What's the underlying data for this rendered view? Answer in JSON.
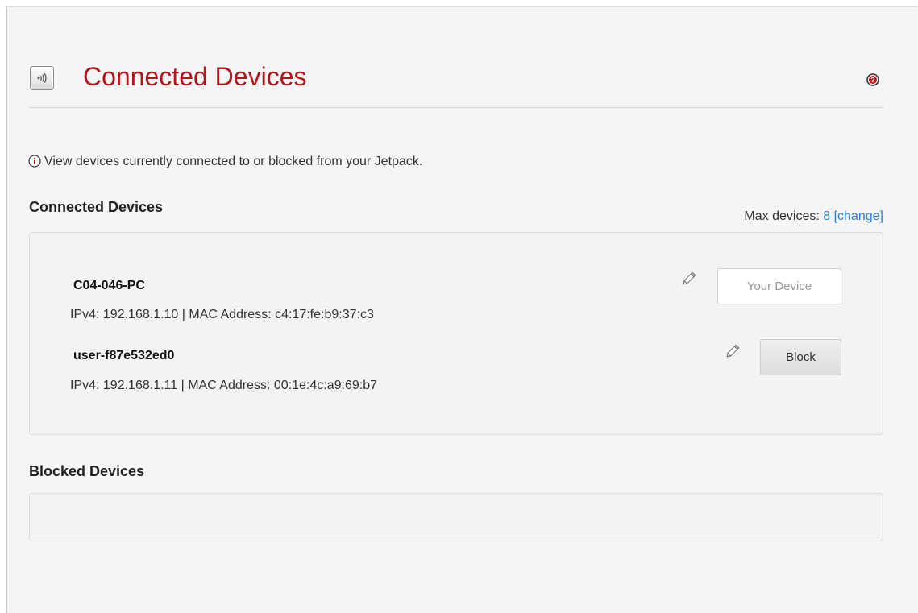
{
  "header": {
    "title": "Connected Devices",
    "device_icon": "wireless-device-icon",
    "help_icon": "help-icon"
  },
  "info": {
    "icon": "info-icon",
    "text": "View devices currently connected to or blocked from your Jetpack."
  },
  "connected_section": {
    "title": "Connected Devices",
    "max_devices_label": "Max devices:",
    "max_devices_value": "8",
    "change_link": "[change]"
  },
  "devices": [
    {
      "name": "C04-046-PC",
      "details": "IPv4: 192.168.1.10 | MAC Address: c4:17:fe:b9:37:c3",
      "edit_icon": "pencil-icon",
      "button_label": "Your Device"
    },
    {
      "name": "user-f87e532ed0",
      "details": "IPv4: 192.168.1.11 | MAC Address: 00:1e:4c:a9:69:b7",
      "edit_icon": "pencil-icon",
      "button_label": "Block"
    }
  ],
  "blocked_section": {
    "title": "Blocked Devices"
  },
  "colors": {
    "title_red": "#b0151c",
    "link_blue": "#2a7fd4",
    "panel_bg": "#f3f3f3",
    "page_bg": "#f5f5f5"
  }
}
